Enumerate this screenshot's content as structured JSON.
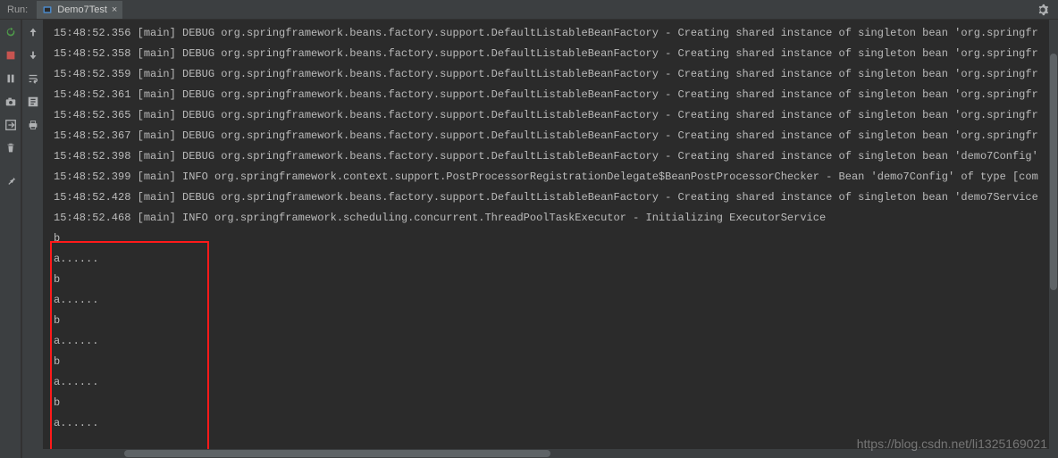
{
  "header": {
    "run_label": "Run:",
    "tab_label": "Demo7Test",
    "tab_close": "×"
  },
  "console_lines": [
    "15:48:52.356 [main] DEBUG org.springframework.beans.factory.support.DefaultListableBeanFactory - Creating shared instance of singleton bean 'org.springfr",
    "15:48:52.358 [main] DEBUG org.springframework.beans.factory.support.DefaultListableBeanFactory - Creating shared instance of singleton bean 'org.springfr",
    "15:48:52.359 [main] DEBUG org.springframework.beans.factory.support.DefaultListableBeanFactory - Creating shared instance of singleton bean 'org.springfr",
    "15:48:52.361 [main] DEBUG org.springframework.beans.factory.support.DefaultListableBeanFactory - Creating shared instance of singleton bean 'org.springfr",
    "15:48:52.365 [main] DEBUG org.springframework.beans.factory.support.DefaultListableBeanFactory - Creating shared instance of singleton bean 'org.springfr",
    "15:48:52.367 [main] DEBUG org.springframework.beans.factory.support.DefaultListableBeanFactory - Creating shared instance of singleton bean 'org.springfr",
    "15:48:52.398 [main] DEBUG org.springframework.beans.factory.support.DefaultListableBeanFactory - Creating shared instance of singleton bean 'demo7Config'",
    "15:48:52.399 [main] INFO org.springframework.context.support.PostProcessorRegistrationDelegate$BeanPostProcessorChecker - Bean 'demo7Config' of type [com",
    "15:48:52.428 [main] DEBUG org.springframework.beans.factory.support.DefaultListableBeanFactory - Creating shared instance of singleton bean 'demo7Service",
    "15:48:52.468 [main] INFO org.springframework.scheduling.concurrent.ThreadPoolTaskExecutor - Initializing ExecutorService",
    "b",
    "a......",
    "b",
    "a......",
    "b",
    "a......",
    "b",
    "a......",
    "b",
    "a......"
  ],
  "watermark": "https://blog.csdn.net/li1325169021"
}
